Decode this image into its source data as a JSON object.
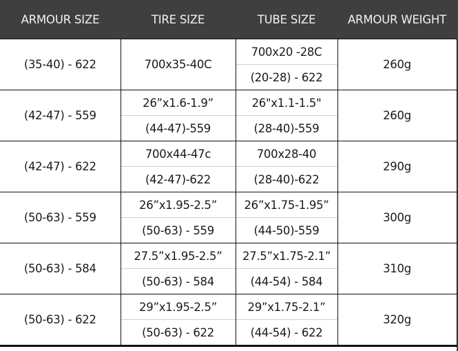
{
  "table": {
    "headers": [
      "ARMOUR SIZE",
      "TIRE SIZE",
      "TUBE SIZE",
      "ARMOUR WEIGHT"
    ],
    "rows": [
      {
        "armour_size": "(35-40) - 622",
        "tire_size": [
          "700x35-40C"
        ],
        "tube_size": [
          "700x20 -28C",
          "(20-28) - 622"
        ],
        "armour_weight": "260g"
      },
      {
        "armour_size": "(42-47) - 559",
        "tire_size": [
          "26”x1.6-1.9”",
          "(44-47)-559"
        ],
        "tube_size": [
          "26\"x1.1-1.5\"",
          "(28-40)-559"
        ],
        "armour_weight": "260g"
      },
      {
        "armour_size": "(42-47) - 622",
        "tire_size": [
          "700x44-47c",
          "(42-47)-622"
        ],
        "tube_size": [
          "700x28-40",
          "(28-40)-622"
        ],
        "armour_weight": "290g"
      },
      {
        "armour_size": "(50-63) - 559",
        "tire_size": [
          "26”x1.95-2.5”",
          "(50-63) - 559"
        ],
        "tube_size": [
          "26”x1.75-1.95”",
          "(44-50)-559"
        ],
        "armour_weight": "300g"
      },
      {
        "armour_size": "(50-63) - 584",
        "tire_size": [
          "27.5”x1.95-2.5”",
          "(50-63) - 584"
        ],
        "tube_size": [
          "27.5”x1.75-2.1”",
          "(44-54) - 584"
        ],
        "armour_weight": "310g"
      },
      {
        "armour_size": "(50-63) - 622",
        "tire_size": [
          "29”x1.95-2.5”",
          "(50-63) - 622"
        ],
        "tube_size": [
          "29”x1.75-2.1”",
          "(44-54) - 622"
        ],
        "armour_weight": "320g"
      }
    ]
  },
  "colors": {
    "header_bg": "#3f3f3f",
    "header_text": "#f2f2f2",
    "body_text": "#1a1a1a",
    "grid_line": "#111111",
    "sub_divider": "#cfcfcf"
  }
}
